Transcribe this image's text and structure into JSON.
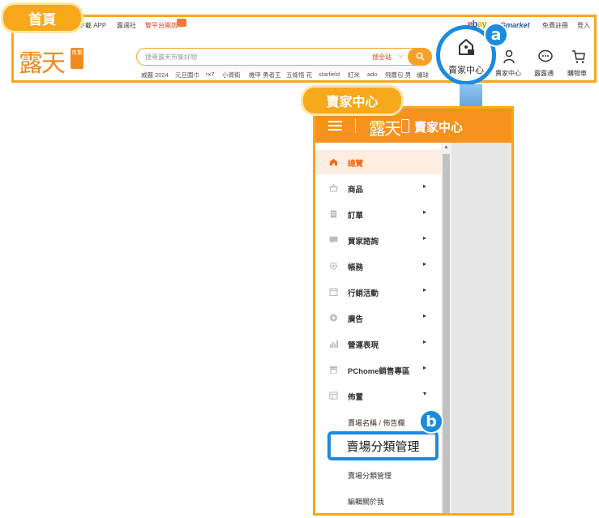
{
  "tags": {
    "home": "首頁",
    "seller_center": "賣家中心"
  },
  "home": {
    "topbar": {
      "app": "下載 APP",
      "news": "露週社",
      "promo": "雙平台開店",
      "free_register": "免費註冊",
      "login": "登入",
      "ebay_letters": [
        "e",
        "b",
        "a",
        "y"
      ],
      "gmarket": "Gmarket"
    },
    "logo_text": "露天",
    "logo_badge": "市集",
    "search": {
      "placeholder": "搜尋露天市集好物",
      "scope": "搜全站",
      "scope_chevron": "⌵"
    },
    "hot_keywords": [
      "威麗 2024",
      "元旦圍巾",
      "rx7",
      "小資衛",
      "機甲 勇者王",
      "五條悟 花",
      "starfield",
      "紅米",
      "ado",
      "飛鷹包 男",
      "繡球"
    ],
    "nav": [
      {
        "label": "賣家中心",
        "icon": "seller-home-icon"
      },
      {
        "label": "賣家中心",
        "icon": "user-icon"
      },
      {
        "label": "露露通",
        "icon": "chat-icon"
      },
      {
        "label": "購物車",
        "icon": "cart-icon"
      }
    ]
  },
  "badges": {
    "a": "a",
    "b": "b"
  },
  "seller": {
    "logo_text": "露天",
    "title": "賣家中心",
    "menu": [
      {
        "label": "總覽",
        "icon": "home-icon",
        "active": true,
        "arrow": ""
      },
      {
        "label": "商品",
        "icon": "basket-icon",
        "active": false,
        "arrow": "▸"
      },
      {
        "label": "訂單",
        "icon": "document-icon",
        "active": false,
        "arrow": "▸"
      },
      {
        "label": "買家諮詢",
        "icon": "message-icon",
        "active": false,
        "arrow": "▸"
      },
      {
        "label": "帳務",
        "icon": "gear-icon",
        "active": false,
        "arrow": "▸"
      },
      {
        "label": "行銷活動",
        "icon": "calendar-icon",
        "active": false,
        "arrow": "▸"
      },
      {
        "label": "廣告",
        "icon": "ad-icon",
        "active": false,
        "arrow": "▸"
      },
      {
        "label": "營運表現",
        "icon": "bar-chart-icon",
        "active": false,
        "arrow": "▸"
      },
      {
        "label": "PChome銷售專區",
        "icon": "store-icon",
        "active": false,
        "arrow": "▸"
      },
      {
        "label": "佈置",
        "icon": "layout-icon",
        "active": false,
        "arrow": "▾"
      }
    ],
    "submenu": [
      "賣場名稱 / 佈告欄",
      "賣場分類管理",
      "編輯關於我"
    ],
    "highlight": "賣場分類管理"
  },
  "colors": {
    "orange": "#f7921e",
    "tag": "#f7a81b",
    "highlight_blue": "#1b8be0"
  }
}
